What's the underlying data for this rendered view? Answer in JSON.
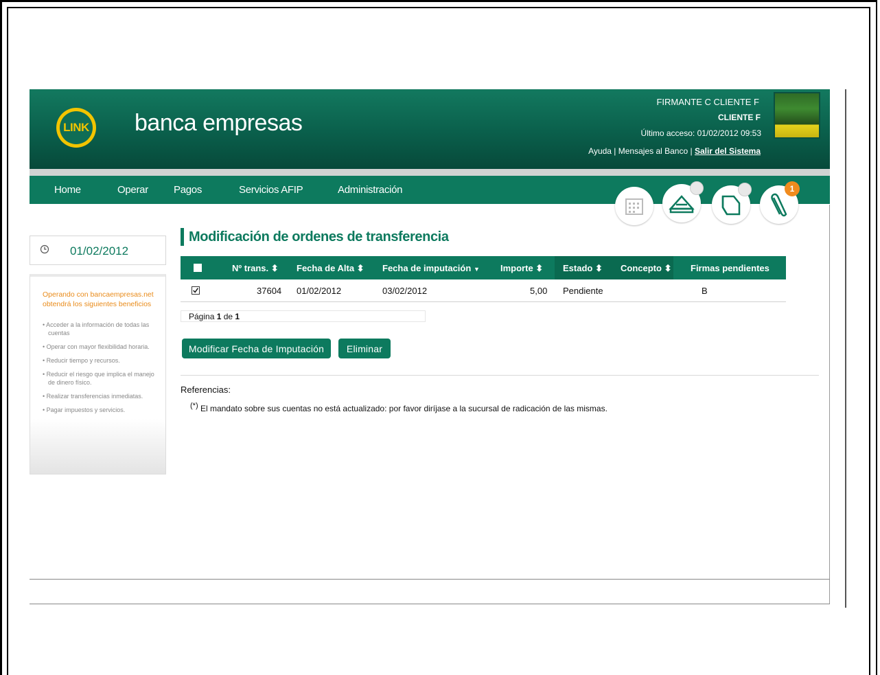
{
  "header": {
    "logo_text": "LINK",
    "brand": "banca empresas",
    "user_name": "FIRMANTE C CLIENTE F",
    "client": "CLIENTE F",
    "last_access": "Último acceso: 01/02/2012 09:53",
    "links": {
      "help": "Ayuda",
      "separator": " | ",
      "messages": "Mensajes al Banco",
      "exit": "Salir del Sistema"
    }
  },
  "nav": {
    "items": [
      "Home",
      "Operar",
      "Pagos",
      "Servicios AFIP",
      "Administración"
    ],
    "icons": [
      "calendar-icon",
      "envelope-icon",
      "folder-icon",
      "paperclip-icon"
    ],
    "badge": "1"
  },
  "sidebar": {
    "date": "01/02/2012",
    "promo_title": "Operando con bancaempresas.net obtendrá los siguientes beneficios",
    "benefits": [
      "Acceder a la información de todas las cuentas",
      "Operar con mayor flexibilidad horaria.",
      "Reducir tiempo y recursos.",
      "Reducir el riesgo que implica el manejo de dinero físico.",
      "Realizar transferencias inmediatas.",
      "Pagar impuestos y servicios."
    ]
  },
  "main": {
    "title": "Modificación de ordenes de transferencia",
    "table": {
      "columns": [
        "Nº trans.",
        "Fecha de Alta",
        "Fecha de imputación",
        "Importe",
        "Estado",
        "Concepto",
        "Firmas pendientes"
      ],
      "sort_up_down": "⬍",
      "sort_down": "▼",
      "rows": [
        {
          "n_trans": "37604",
          "fecha_alta": "01/02/2012",
          "fecha_imputacion": "03/02/2012",
          "importe": "5,00",
          "estado": "Pendiente",
          "concepto": "",
          "firmas": "B"
        }
      ]
    },
    "pager": {
      "prefix": "Página ",
      "current": "1",
      "mid": " de ",
      "total": "1"
    },
    "buttons": {
      "modify": "Modificar Fecha de Imputación",
      "delete": "Eliminar"
    },
    "references": {
      "label": "Referencias:",
      "mark": "(*)",
      "text": " El mandato sobre sus cuentas no está actualizado: por favor diríjase a la sucursal de radicación de las mismas."
    }
  },
  "colors": {
    "brand_green": "#0d7a5e",
    "accent_orange": "#e98b1a"
  }
}
